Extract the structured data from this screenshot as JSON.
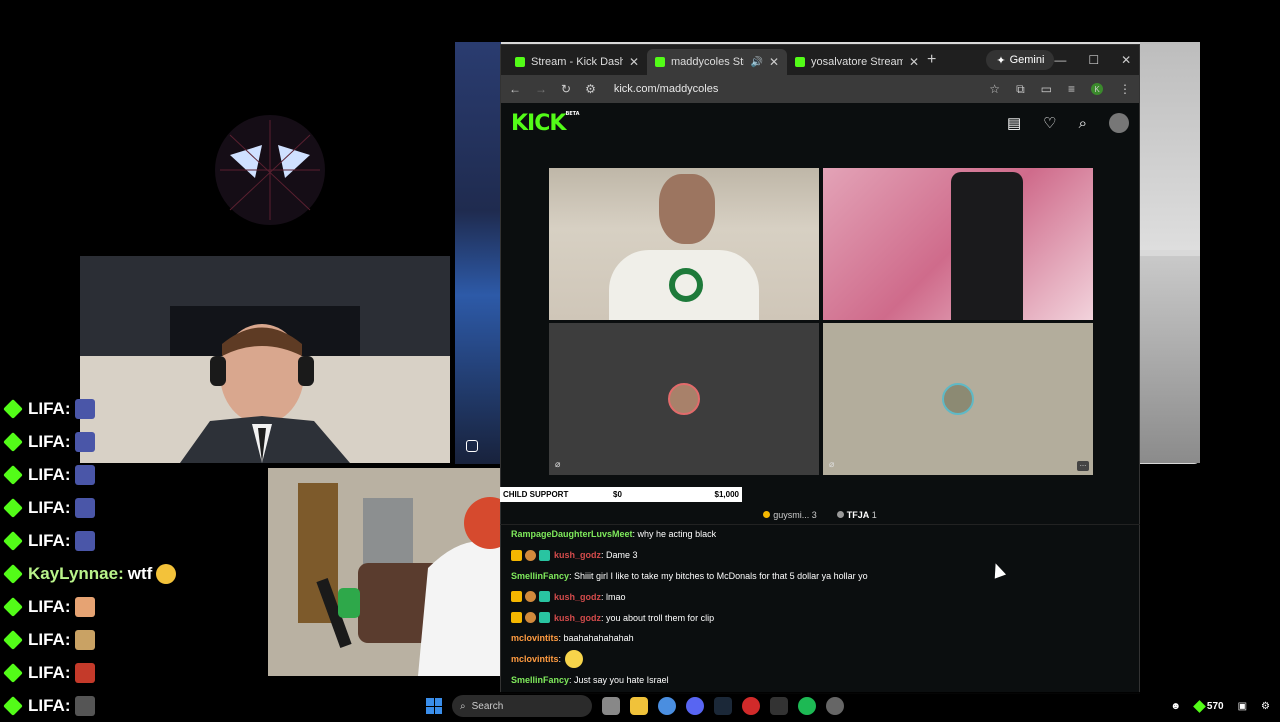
{
  "alerts": [
    {
      "name": "LIFA:",
      "text": ""
    },
    {
      "name": "LIFA:",
      "text": ""
    },
    {
      "name": "LIFA:",
      "text": ""
    },
    {
      "name": "LIFA:",
      "text": ""
    },
    {
      "name": "LIFA:",
      "text": ""
    },
    {
      "name": "KayLynnae:",
      "text": "wtf"
    },
    {
      "name": "LIFA:",
      "text": ""
    },
    {
      "name": "LIFA:",
      "text": ""
    },
    {
      "name": "LIFA:",
      "text": ""
    },
    {
      "name": "LIFA:",
      "text": ""
    }
  ],
  "browser": {
    "tabs": [
      {
        "label": "Stream - Kick Dashboard",
        "close": "✕"
      },
      {
        "label": "maddycoles Stream -",
        "close": "✕"
      },
      {
        "label": "yosalvatore Stream - Wa",
        "close": "✕"
      }
    ],
    "new_tab": "+",
    "gemini": "Gemini",
    "url": "kick.com/maddycoles",
    "profile_initial": "K"
  },
  "goal": {
    "label": "CHILD SUPPORT",
    "current": "$0",
    "target": "$1,000"
  },
  "chat_top": {
    "gifter_name": "guysmi...",
    "gifter_count": "3",
    "tfja_name": "TFJA",
    "tfja_count": "1"
  },
  "chat": [
    {
      "user": "RampageDaughterLuvsMeet",
      "color": "green",
      "badges": false,
      "text": ": why he acting black"
    },
    {
      "user": "kush_godz",
      "color": "red",
      "badges": true,
      "text": ": Dame 3"
    },
    {
      "user": "SmellinFancy",
      "color": "green",
      "badges": false,
      "text": ": Shiiit girl I like to take my bitches to McDonals for that 5 dollar ya hollar yo"
    },
    {
      "user": "kush_godz",
      "color": "red",
      "badges": true,
      "text": ": lmao"
    },
    {
      "user": "kush_godz",
      "color": "red",
      "badges": true,
      "text": ": you about troll them for clip"
    },
    {
      "user": "mclovintits",
      "color": "orange",
      "badges": false,
      "text": ": baahahahahahah"
    },
    {
      "user": "mclovintits",
      "color": "orange",
      "badges": false,
      "text": ":",
      "emoji": true
    },
    {
      "user": "SmellinFancy",
      "color": "green",
      "badges": false,
      "text": ": Just say you hate Israel"
    }
  ],
  "taskbar": {
    "search": "Search",
    "points": "570"
  }
}
